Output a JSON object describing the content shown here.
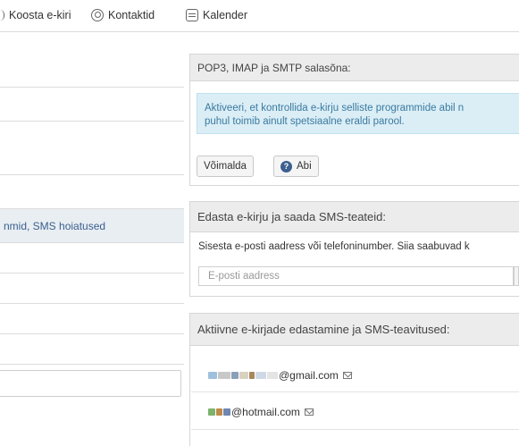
{
  "nav": {
    "compose": "Koosta e-kiri",
    "contacts": "Kontaktid",
    "calendar": "Kalender"
  },
  "sidebar": {
    "selected_item": "nmid, SMS hoiatused"
  },
  "password_panel": {
    "title": "POP3, IMAP ja SMTP salasõna:",
    "info_line1": "Aktiveeri, et kontrollida e-kirju selliste programmide abil n",
    "info_line2": "puhul toimib ainult spetsiaalne eraldi parool.",
    "enable_button": "Võimalda",
    "help_button": "Abi"
  },
  "forward_panel": {
    "title": "Edasta e-kirju ja saada SMS-teateid:",
    "description": "Sisesta e-posti aadress või telefoninumber. Siia saabuvad k",
    "email_placeholder": "E-posti aadress"
  },
  "active_panel": {
    "title": "Aktiivne e-kirjade edastamine ja SMS-teavitused:",
    "emails": [
      "@gmail.com",
      "@hotmail.com"
    ]
  },
  "colors": {
    "link": "#3a5f8e",
    "info_bg": "#dbeef6",
    "info_text": "#3a7aa0",
    "panel_header": "#ececec"
  }
}
